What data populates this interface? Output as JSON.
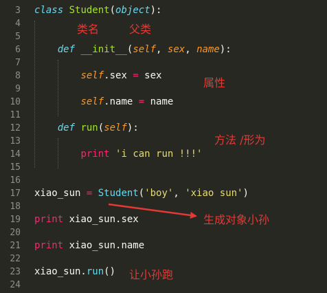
{
  "lines": [
    {
      "n": "3",
      "tokens": [
        [
          "class",
          "kw-store"
        ],
        [
          " ",
          ""
        ],
        [
          "Student",
          "cls"
        ],
        [
          "(",
          ""
        ],
        [
          "object",
          "builtin"
        ],
        [
          "):",
          ""
        ]
      ]
    },
    {
      "n": "4",
      "tokens": []
    },
    {
      "n": "5",
      "tokens": []
    },
    {
      "n": "6",
      "tokens": [
        [
          "    ",
          ""
        ],
        [
          "def",
          "kw-store"
        ],
        [
          " ",
          ""
        ],
        [
          "__init__",
          "fn"
        ],
        [
          "(",
          ""
        ],
        [
          "self",
          "self"
        ],
        [
          ", ",
          ""
        ],
        [
          "sex",
          "param"
        ],
        [
          ", ",
          ""
        ],
        [
          "name",
          "param"
        ],
        [
          "):",
          ""
        ]
      ]
    },
    {
      "n": "7",
      "tokens": []
    },
    {
      "n": "8",
      "tokens": [
        [
          "        ",
          ""
        ],
        [
          "self",
          "self"
        ],
        [
          ".sex ",
          ""
        ],
        [
          "=",
          "kw"
        ],
        [
          " sex",
          ""
        ]
      ]
    },
    {
      "n": "9",
      "tokens": []
    },
    {
      "n": "10",
      "tokens": [
        [
          "        ",
          ""
        ],
        [
          "self",
          "self"
        ],
        [
          ".name ",
          ""
        ],
        [
          "=",
          "kw"
        ],
        [
          " name",
          ""
        ]
      ]
    },
    {
      "n": "11",
      "tokens": []
    },
    {
      "n": "12",
      "tokens": [
        [
          "    ",
          ""
        ],
        [
          "def",
          "kw-store"
        ],
        [
          " ",
          ""
        ],
        [
          "run",
          "fn"
        ],
        [
          "(",
          ""
        ],
        [
          "self",
          "self"
        ],
        [
          "):",
          ""
        ]
      ]
    },
    {
      "n": "13",
      "tokens": []
    },
    {
      "n": "14",
      "tokens": [
        [
          "        ",
          ""
        ],
        [
          "print",
          "kw"
        ],
        [
          " ",
          ""
        ],
        [
          "'i can run !!!'",
          "str"
        ]
      ]
    },
    {
      "n": "15",
      "tokens": []
    },
    {
      "n": "16",
      "tokens": []
    },
    {
      "n": "17",
      "tokens": [
        [
          "xiao_sun ",
          ""
        ],
        [
          "=",
          "kw"
        ],
        [
          " ",
          ""
        ],
        [
          "Student",
          "fnc"
        ],
        [
          "(",
          ""
        ],
        [
          "'boy'",
          "str"
        ],
        [
          ", ",
          ""
        ],
        [
          "'xiao sun'",
          "str"
        ],
        [
          ")",
          ""
        ]
      ]
    },
    {
      "n": "18",
      "tokens": []
    },
    {
      "n": "19",
      "tokens": [
        [
          "print",
          "kw"
        ],
        [
          " xiao_sun.sex",
          ""
        ]
      ]
    },
    {
      "n": "20",
      "tokens": []
    },
    {
      "n": "21",
      "tokens": [
        [
          "print",
          "kw"
        ],
        [
          " xiao_sun.name",
          ""
        ]
      ]
    },
    {
      "n": "22",
      "tokens": []
    },
    {
      "n": "23",
      "tokens": [
        [
          "xiao_sun.",
          ""
        ],
        [
          "run",
          "fnc"
        ],
        [
          "()",
          ""
        ]
      ]
    },
    {
      "n": "24",
      "tokens": []
    }
  ],
  "annotations": {
    "class_name": "类名",
    "parent_class": "父类",
    "attribute": "属性",
    "method": "方法 /形为",
    "create_object": "生成对象小孙",
    "let_run": "让小孙跑"
  },
  "colors": {
    "background": "#272822",
    "annotation": "#e53935"
  }
}
